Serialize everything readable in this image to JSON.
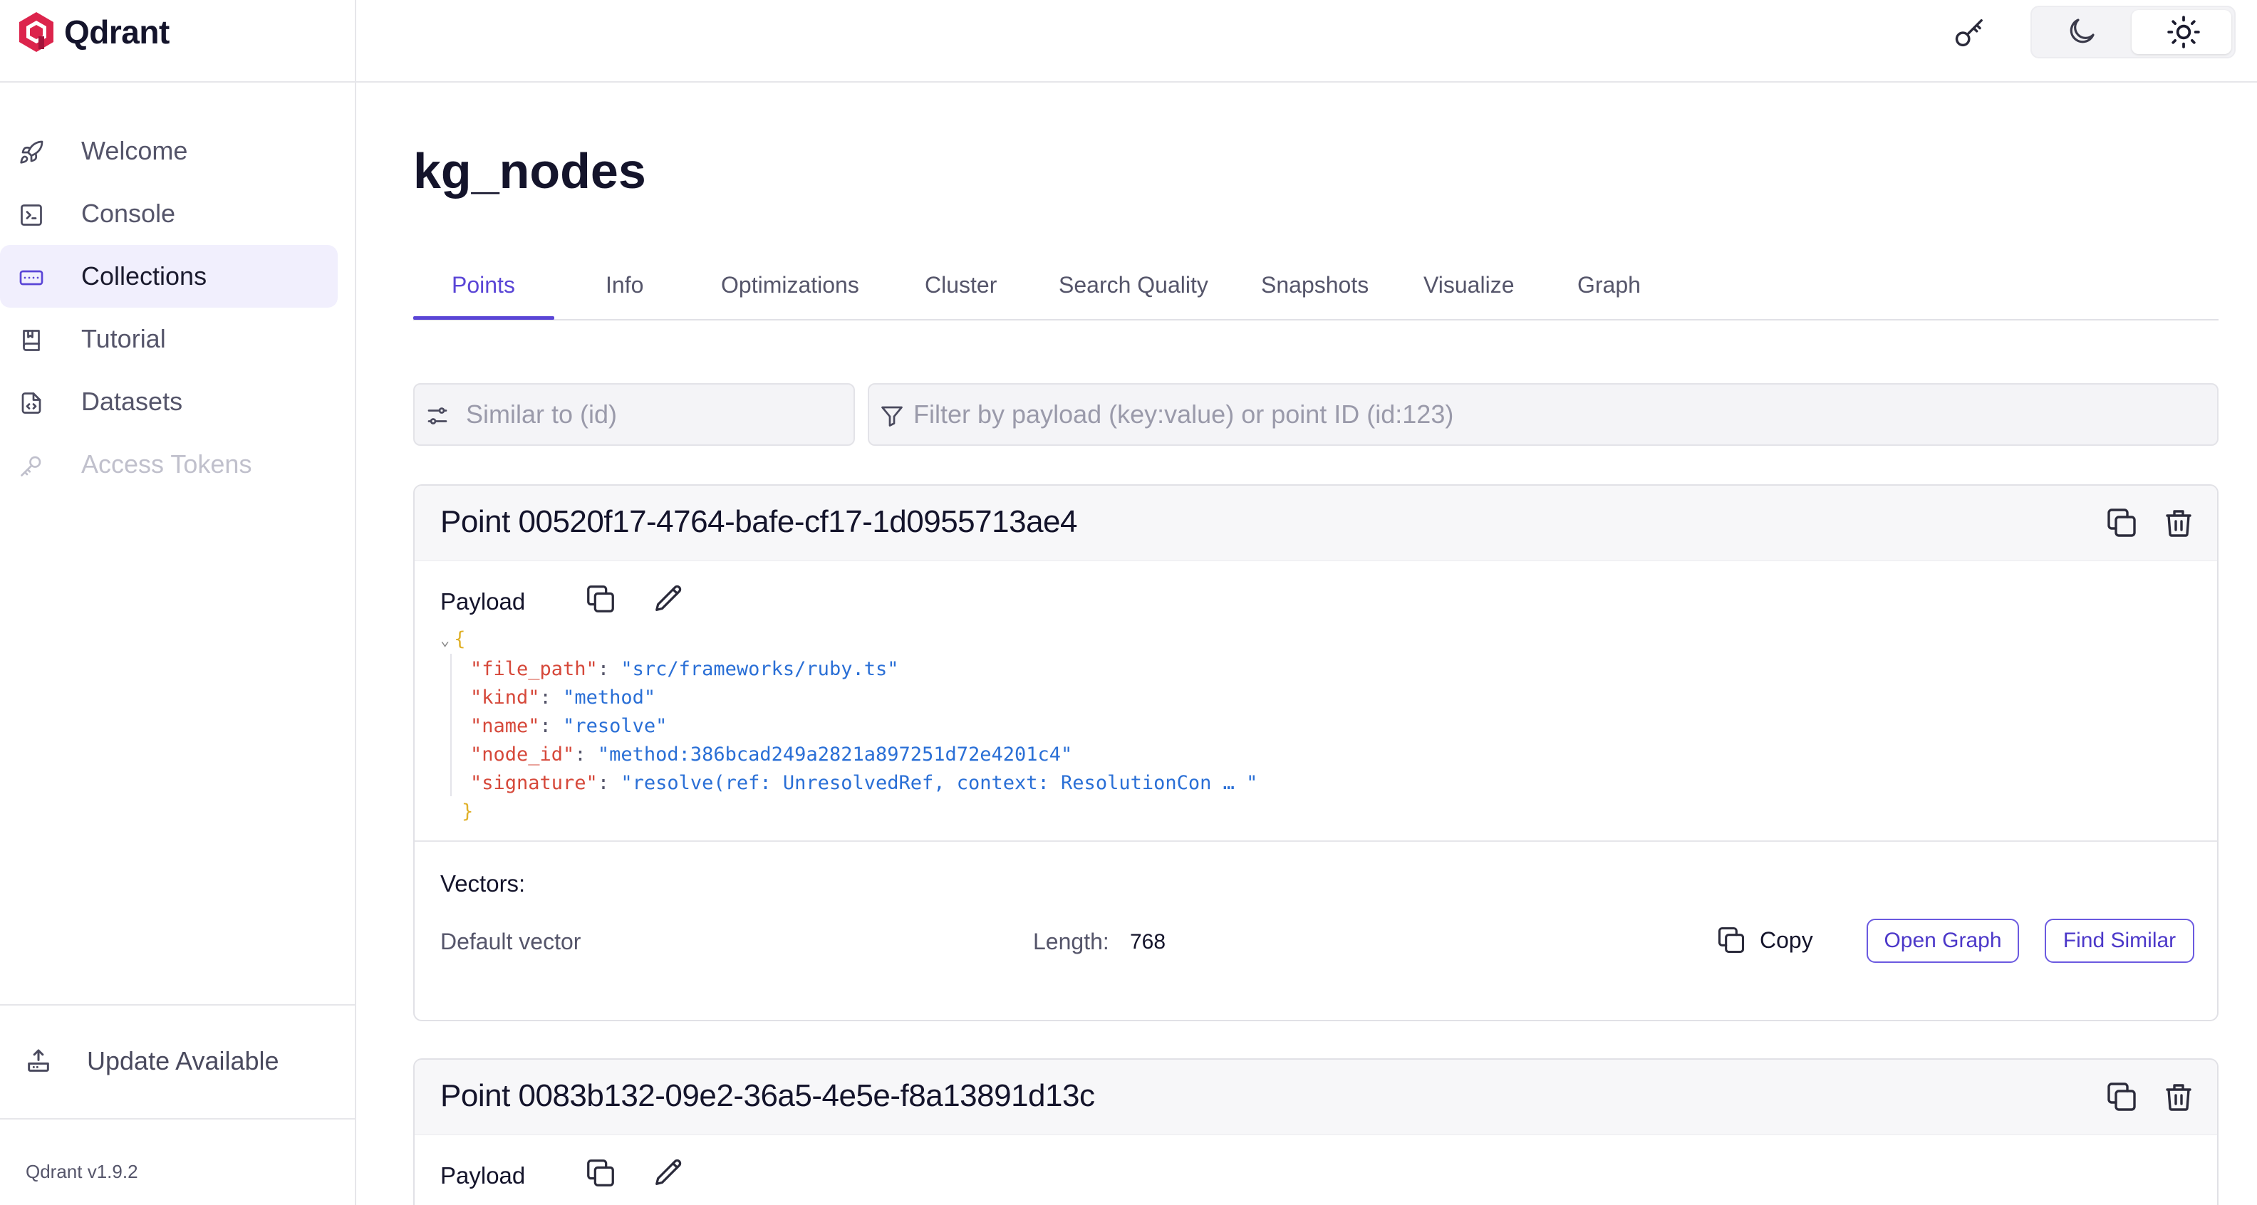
{
  "app": {
    "name": "Qdrant",
    "version": "Qdrant v1.9.2",
    "accent": "#5a45d6",
    "logo_color": "#dc244c"
  },
  "sidebar": {
    "items": [
      {
        "label": "Welcome",
        "icon": "rocket-icon",
        "active": false,
        "disabled": false
      },
      {
        "label": "Console",
        "icon": "terminal-icon",
        "active": false,
        "disabled": false
      },
      {
        "label": "Collections",
        "icon": "collections-icon",
        "active": true,
        "disabled": false
      },
      {
        "label": "Tutorial",
        "icon": "book-icon",
        "active": false,
        "disabled": false
      },
      {
        "label": "Datasets",
        "icon": "dataset-file-icon",
        "active": false,
        "disabled": false
      },
      {
        "label": "Access Tokens",
        "icon": "key-icon",
        "active": false,
        "disabled": true
      }
    ],
    "update_label": "Update Available"
  },
  "topbar": {
    "icons": [
      "key-icon",
      "moon-icon",
      "sun-icon"
    ],
    "theme_selected": "light"
  },
  "collection": {
    "title": "kg_nodes"
  },
  "tabs": [
    {
      "label": "Points",
      "active": true
    },
    {
      "label": "Info",
      "active": false
    },
    {
      "label": "Optimizations",
      "active": false
    },
    {
      "label": "Cluster",
      "active": false
    },
    {
      "label": "Search Quality",
      "active": false
    },
    {
      "label": "Snapshots",
      "active": false
    },
    {
      "label": "Visualize",
      "active": false
    },
    {
      "label": "Graph",
      "active": false
    }
  ],
  "search": {
    "similar_placeholder": "Similar to (id)",
    "filter_placeholder": "Filter by payload (key:value) or point ID (id:123)"
  },
  "points": [
    {
      "title": "Point 00520f17-4764-bafe-cf17-1d0955713ae4",
      "payload_label": "Payload",
      "payload": [
        {
          "key": "\"file_path\"",
          "value": "\"src/frameworks/ruby.ts\""
        },
        {
          "key": "\"kind\"",
          "value": "\"method\""
        },
        {
          "key": "\"name\"",
          "value": "\"resolve\""
        },
        {
          "key": "\"node_id\"",
          "value": "\"method:386bcad249a2821a897251d72e4201c4\""
        },
        {
          "key": "\"signature\"",
          "value": "\"resolve(ref: UnresolvedRef, context: ResolutionCon … \""
        }
      ],
      "vectors_label": "Vectors:",
      "vector_name": "Default vector",
      "length_label": "Length:",
      "length_value": "768",
      "copy_label": "Copy",
      "open_graph_label": "Open Graph",
      "find_similar_label": "Find Similar"
    },
    {
      "title": "Point 0083b132-09e2-36a5-4e5e-f8a13891d13c",
      "payload_label": "Payload"
    }
  ],
  "json_braces": {
    "open": "{",
    "close": "}",
    "colon": ":",
    "chevron": "⌄"
  }
}
